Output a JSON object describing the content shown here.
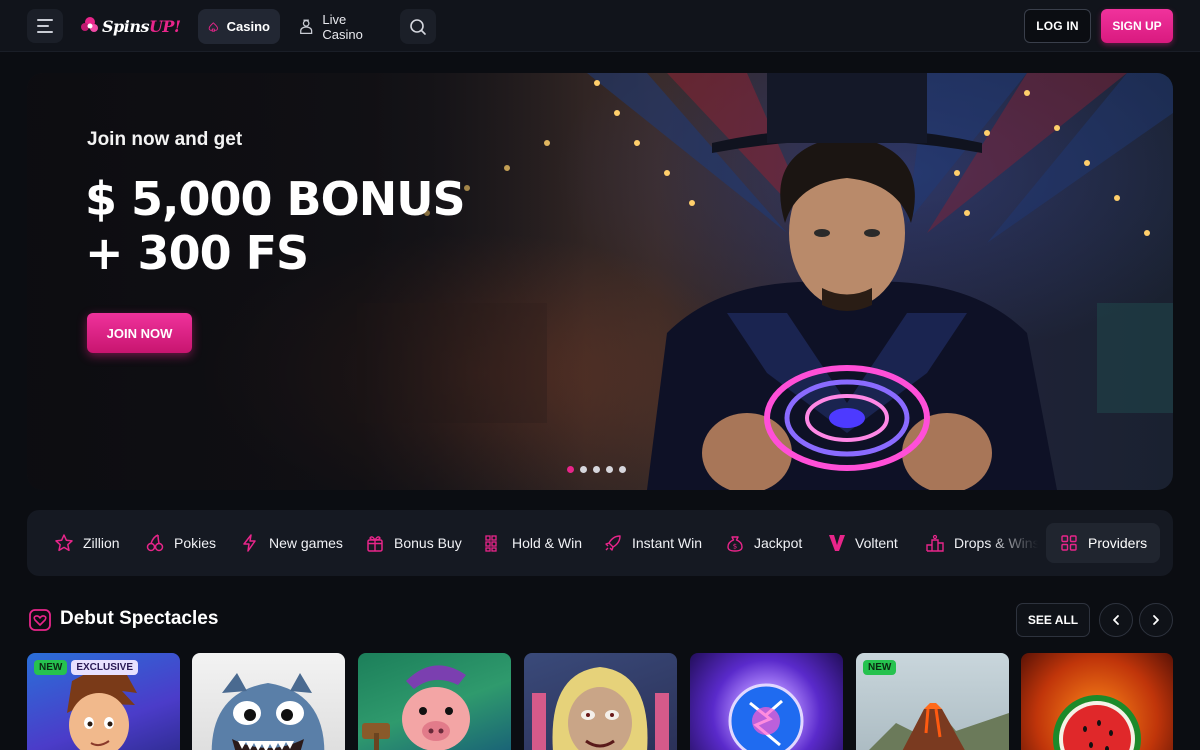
{
  "header": {
    "logo_text_a": "Spins",
    "logo_text_b": "UP!",
    "nav": [
      {
        "label": "Casino",
        "icon": "spade-icon",
        "active": true
      },
      {
        "label": "Live Casino",
        "icon": "dealer-icon",
        "active": false
      }
    ],
    "login_label": "LOG IN",
    "signup_label": "SIGN UP"
  },
  "hero": {
    "intro": "Join now and get",
    "headline_1": "$ 5,000 BONUS",
    "headline_2": "+ 300 FS",
    "cta": "JOIN NOW",
    "slides": 5,
    "active_slide": 1
  },
  "categories": [
    {
      "label": "Zillion",
      "icon": "star-icon"
    },
    {
      "label": "Pokies",
      "icon": "cherries-icon"
    },
    {
      "label": "New games",
      "icon": "lightning-icon"
    },
    {
      "label": "Bonus Buy",
      "icon": "gift-icon"
    },
    {
      "label": "Hold & Win",
      "icon": "grid-icon"
    },
    {
      "label": "Instant Win",
      "icon": "rocket-icon"
    },
    {
      "label": "Jackpot",
      "icon": "money-bag-icon"
    },
    {
      "label": "Voltent",
      "icon": "voltent-logo-icon"
    },
    {
      "label": "Drops & Wins",
      "icon": "podium-icon"
    },
    {
      "label": "Providers",
      "icon": "providers-grid-icon"
    }
  ],
  "section": {
    "title": "Debut Spectacles",
    "see_all": "SEE ALL"
  },
  "games": [
    {
      "badges": [
        "NEW",
        "EXCLUSIVE"
      ],
      "theme": "cartoon-hero"
    },
    {
      "badges": [],
      "theme": "blue-monster"
    },
    {
      "badges": [],
      "theme": "pig-hammer"
    },
    {
      "badges": [],
      "theme": "rock-zombie"
    },
    {
      "badges": [],
      "theme": "energy-orb"
    },
    {
      "badges": [
        "NEW"
      ],
      "theme": "volcano"
    },
    {
      "badges": [],
      "theme": "watermelon"
    }
  ],
  "colors": {
    "brand_pink": "#e8258a",
    "badge_new": "#26c24f",
    "background": "#0b0d12"
  }
}
